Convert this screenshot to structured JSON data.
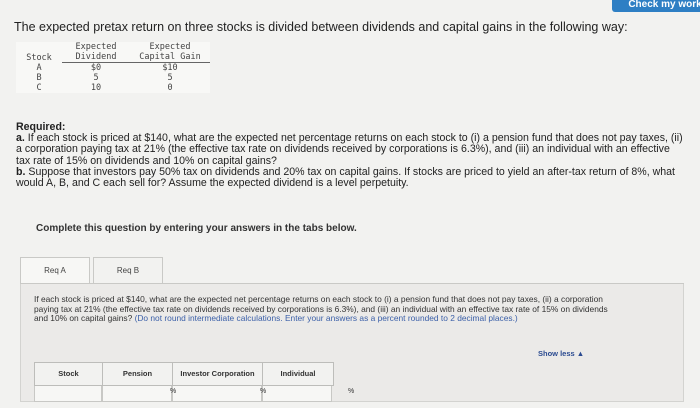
{
  "check_button": "Check my work",
  "intro": "The expected pretax return on three stocks is divided between dividends and capital gains in the following way:",
  "stock_table": {
    "headers": {
      "stock": "Stock",
      "dividend_1": "Expected",
      "dividend_2": "Dividend",
      "gain_1": "Expected",
      "gain_2": "Capital Gain"
    },
    "rows": [
      {
        "stock": "A",
        "dividend": "$0",
        "gain": "$10"
      },
      {
        "stock": "B",
        "dividend": "5",
        "gain": "5"
      },
      {
        "stock": "C",
        "dividend": "10",
        "gain": "0"
      }
    ]
  },
  "required": {
    "heading": "Required:",
    "a_label": "a.",
    "a_text": "If each stock is priced at $140, what are the expected net percentage returns on each stock to (i) a pension fund that does not pay taxes, (ii) a corporation paying tax at 21% (the effective tax rate on dividends received by corporations is 6.3%), and (iii) an individual with an effective tax rate of 15% on dividends and 10% on capital gains?",
    "b_label": "b.",
    "b_text": "Suppose that investors pay 50% tax on dividends and 20% tax on capital gains. If stocks are priced to yield an after-tax return of 8%, what would A, B, and C each sell for? Assume the expected dividend is a level perpetuity."
  },
  "instructions": "Complete this question by entering your answers in the tabs below.",
  "tabs": [
    {
      "label": "Req A"
    },
    {
      "label": "Req B"
    }
  ],
  "question": {
    "text": "If each stock is priced at $140, what are the expected net percentage returns on each stock to (i) a pension fund that does not pay taxes, (ii) a corporation paying tax at 21% (the effective tax rate on dividends received by corporations is 6.3%), and (iii) an individual with an effective tax rate of 15% on dividends and 10% on capital gains?",
    "note": "(Do not round intermediate calculations. Enter your answers as a percent rounded to 2 decimal places.)"
  },
  "show_less": "Show less ▲",
  "answer_table": {
    "headers": [
      "Stock",
      "Pension",
      "Investor Corporation",
      "Individual"
    ],
    "unit": "%"
  }
}
